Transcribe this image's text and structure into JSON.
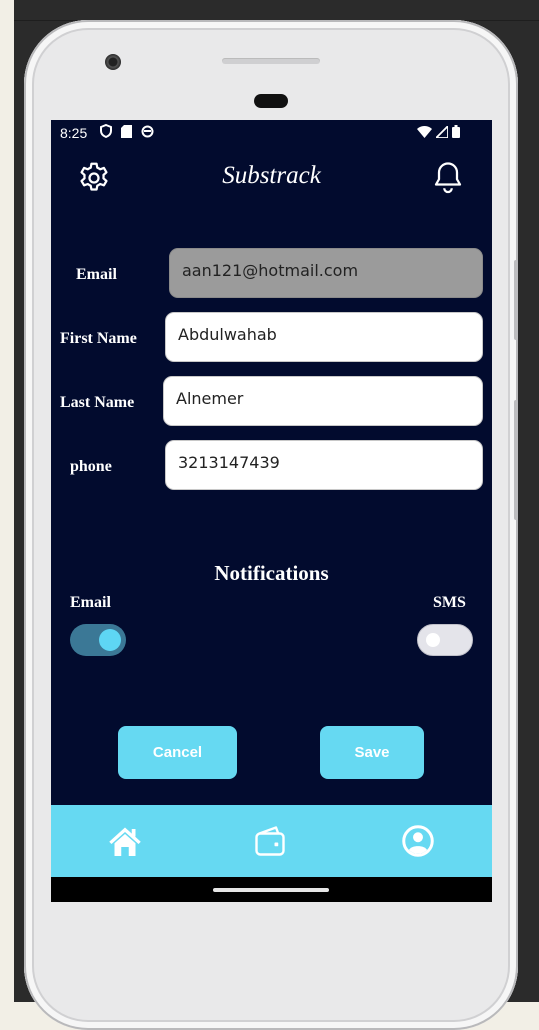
{
  "status_bar": {
    "time": "8:25",
    "left_icons": [
      "vpn-shield-icon",
      "sd-card-icon",
      "sync-circle-icon"
    ],
    "right_icons": [
      "wifi-icon",
      "signal-icon",
      "battery-icon"
    ]
  },
  "app_bar": {
    "title": "Substrack",
    "left_icon": "settings-gear-icon",
    "right_icon": "notifications-bell-icon"
  },
  "form": {
    "email": {
      "label": "Email",
      "value": "aan121@hotmail.com",
      "disabled": true
    },
    "first_name": {
      "label": "First Name",
      "value": "Abdulwahab"
    },
    "last_name": {
      "label": "Last Name",
      "value": "Alnemer"
    },
    "phone": {
      "label": "phone",
      "value": "3213147439"
    }
  },
  "notifications": {
    "title": "Notifications",
    "email": {
      "label": "Email",
      "enabled": true
    },
    "sms": {
      "label": "SMS",
      "enabled": false
    }
  },
  "actions": {
    "cancel_label": "Cancel",
    "save_label": "Save"
  },
  "bottom_nav": {
    "items": [
      "home-icon",
      "wallet-icon",
      "profile-icon"
    ]
  },
  "colors": {
    "screen_bg": "#020b2e",
    "accent": "#66d9f2",
    "toggle_on_track": "#3b7896",
    "disabled_field": "#9b9b9b"
  }
}
